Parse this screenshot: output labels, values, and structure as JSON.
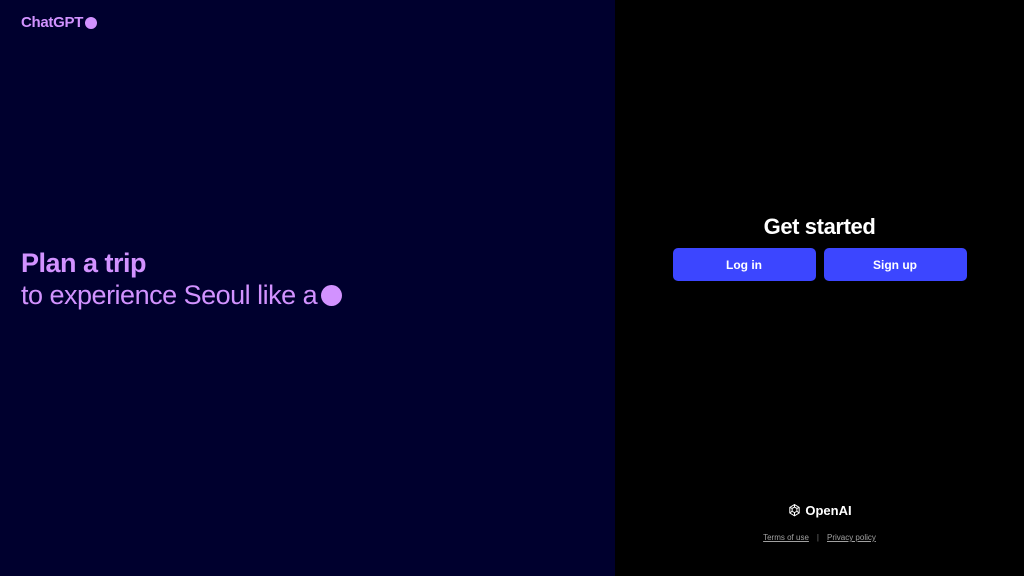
{
  "brand": {
    "name": "ChatGPT",
    "color": "#d292ff"
  },
  "hero": {
    "line1": "Plan a trip",
    "line2": "to experience Seoul like a"
  },
  "auth": {
    "title": "Get started",
    "login_label": "Log in",
    "signup_label": "Sign up",
    "button_color": "#3c46ff"
  },
  "footer": {
    "logo_text": "OpenAI",
    "logo_icon": "openai-knot-icon",
    "terms_label": "Terms of use",
    "separator": "|",
    "privacy_label": "Privacy policy"
  },
  "colors": {
    "left_bg": "#00002e",
    "right_bg": "#000000"
  }
}
